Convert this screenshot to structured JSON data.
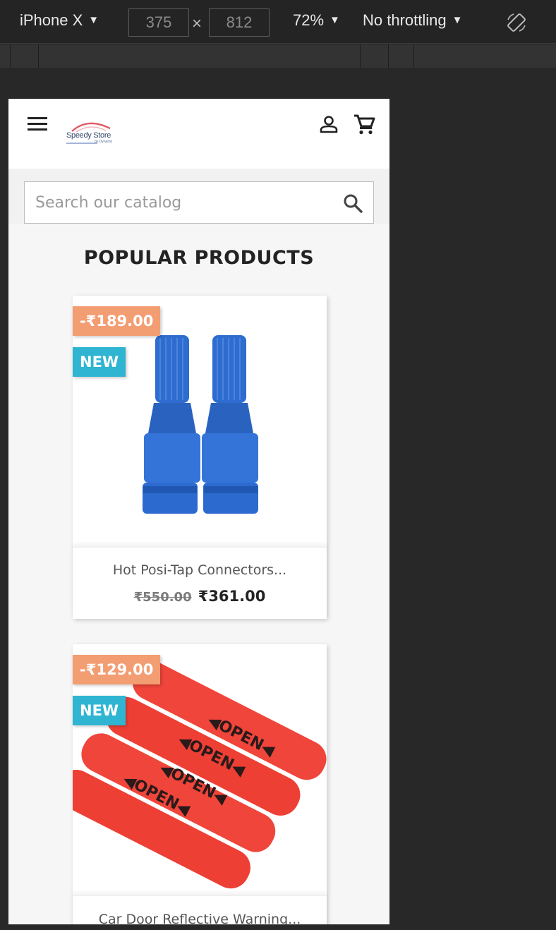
{
  "devtools": {
    "device": "iPhone X",
    "width": "375",
    "height": "812",
    "times": "×",
    "zoom": "72%",
    "throttling": "No throttling",
    "caret": "▼"
  },
  "store": {
    "logo_text": "Speedy Store",
    "logo_sub": "by Dynamo",
    "search_placeholder": "Search our catalog",
    "section_title": "POPULAR PRODUCTS"
  },
  "products": [
    {
      "discount": "-₹189.00",
      "flag": "NEW",
      "name": "Hot Posi-Tap Connectors...",
      "regular_price": "₹550.00",
      "price": "₹361.00"
    },
    {
      "discount": "-₹129.00",
      "flag": "NEW",
      "name": "Car Door Reflective Warning...",
      "regular_price": "",
      "price": ""
    }
  ],
  "sticker_text": "◀OPEN◀",
  "colors": {
    "discount_badge": "#f39d72",
    "new_badge": "#2fb5d2",
    "connector_blue": "#2f6fd0",
    "sticker_red": "#f0453a"
  },
  "icons": [
    "hamburger-icon",
    "user-icon",
    "cart-icon",
    "search-icon",
    "rotate-icon"
  ]
}
